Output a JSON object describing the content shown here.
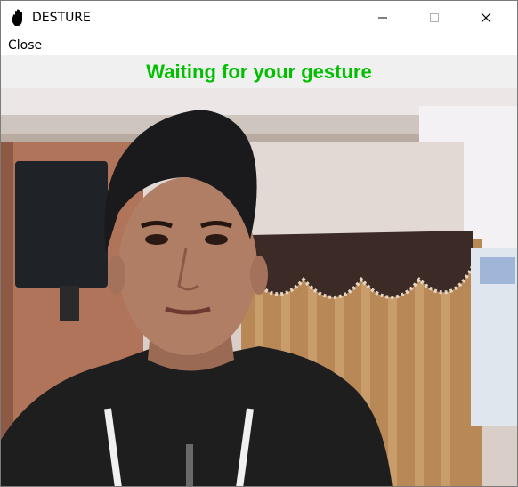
{
  "window": {
    "title": "DESTURE",
    "icon": "hand-icon",
    "controls": {
      "minimize": "minimize-icon",
      "maximize": "maximize-icon",
      "close": "close-icon"
    }
  },
  "menu": {
    "items": [
      {
        "label": "Close"
      }
    ]
  },
  "status": {
    "text": "Waiting for your gesture",
    "color": "#00c000"
  },
  "camera_feed": {
    "description": "webcam-video-frame"
  },
  "colors": {
    "status_background": "#f0f0f0",
    "title_background": "#ffffff"
  }
}
